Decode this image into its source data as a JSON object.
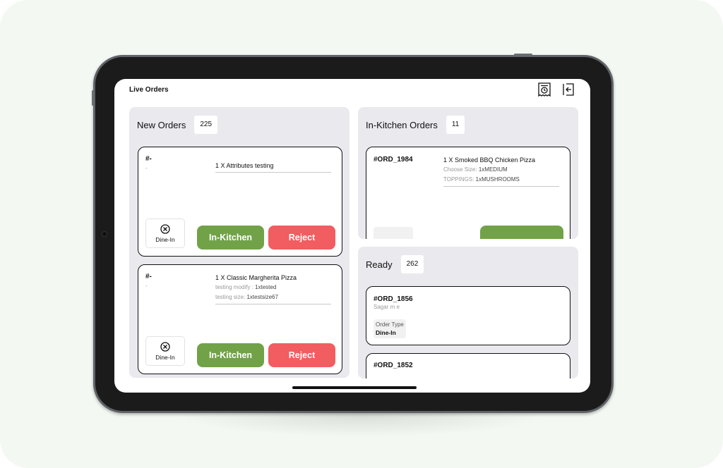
{
  "app": {
    "title": "Live Orders"
  },
  "header_icons": [
    {
      "name": "order-history-icon"
    },
    {
      "name": "logout-icon"
    }
  ],
  "new_orders": {
    "title": "New Orders",
    "count": "225",
    "cards": [
      {
        "id": "#-",
        "sub": "-",
        "items": [
          {
            "line": "1 X Attributes testing",
            "mods": []
          }
        ],
        "order_type": "Dine-In",
        "accept_label": "In-Kitchen",
        "reject_label": "Reject"
      },
      {
        "id": "#-",
        "sub": "-",
        "items": [
          {
            "line": "1 X Classic Margherita Pizza",
            "mods": [
              {
                "k": "testing modify :",
                "v": "1xtested"
              },
              {
                "k": "testing size:",
                "v": "1xtestsize67"
              }
            ]
          }
        ],
        "order_type": "Dine-In",
        "accept_label": "In-Kitchen",
        "reject_label": "Reject"
      }
    ]
  },
  "in_kitchen": {
    "title": "In-Kitchen Orders",
    "count": "11",
    "cards": [
      {
        "id": "#ORD_1984",
        "items": [
          {
            "line": "1 X Smoked BBQ Chicken Pizza",
            "mods": [
              {
                "k": "Choose Size:",
                "v": "1xMEDIUM"
              },
              {
                "k": "TOPPINGS:",
                "v": "1xMUSHROOMS"
              }
            ]
          }
        ]
      }
    ]
  },
  "ready": {
    "title": "Ready",
    "count": "262",
    "cards": [
      {
        "id": "#ORD_1856",
        "sub": "Sagar m e",
        "order_type_label": "Order Type",
        "order_type": "Dine-In"
      },
      {
        "id": "#ORD_1852"
      }
    ]
  },
  "colors": {
    "accept": "#71a248",
    "reject": "#f15d60",
    "panel": "#e9e9ee"
  }
}
